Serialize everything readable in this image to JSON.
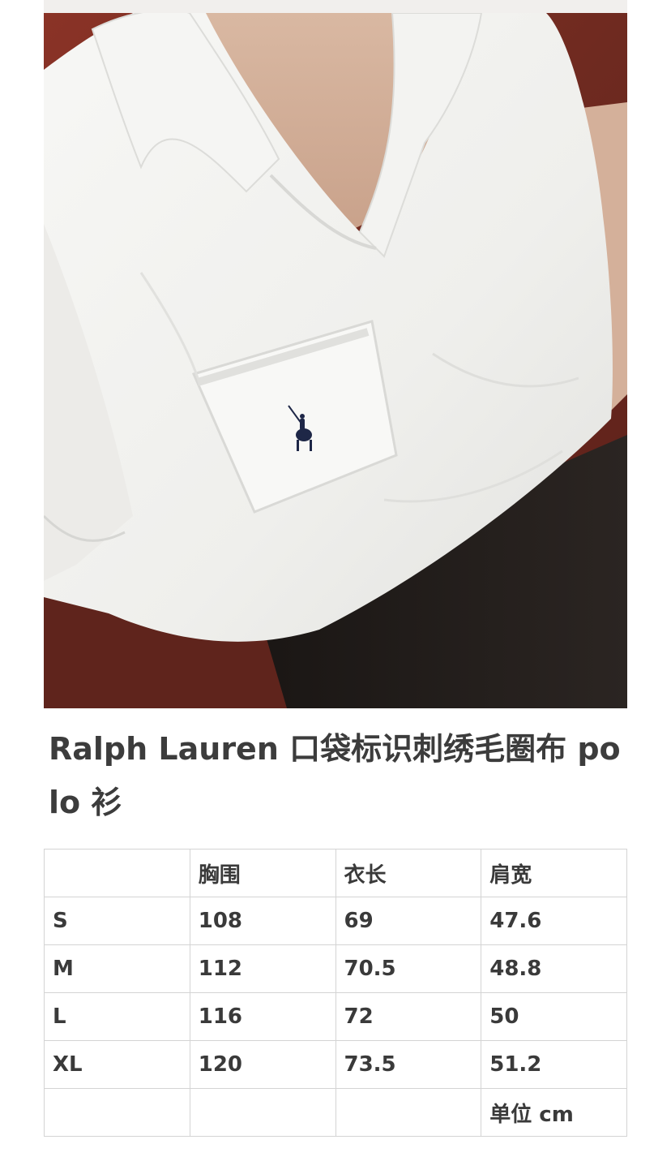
{
  "product": {
    "image_alt": "white terry cloth polo shirt with embroidered pony logo on chest pocket",
    "title": "Ralph Lauren 口袋标识刺绣毛圈布 polo 衫"
  },
  "size_table": {
    "headers": [
      "",
      "胸围",
      "衣长",
      "肩宽"
    ],
    "rows": [
      [
        "S",
        "108",
        "69",
        "47.6"
      ],
      [
        "M",
        "112",
        "70.5",
        "48.8"
      ],
      [
        "L",
        "116",
        "72",
        "50"
      ],
      [
        "XL",
        "120",
        "73.5",
        "51.2"
      ],
      [
        "",
        "",
        "",
        "单位 cm"
      ]
    ]
  },
  "colors": {
    "background": "#ffffff",
    "text": "#3c3c3c",
    "table_border": "#d4d4d4",
    "shirt": "#f2f2f0",
    "sofa": "#7a2d22",
    "logo": "#1e2747"
  }
}
